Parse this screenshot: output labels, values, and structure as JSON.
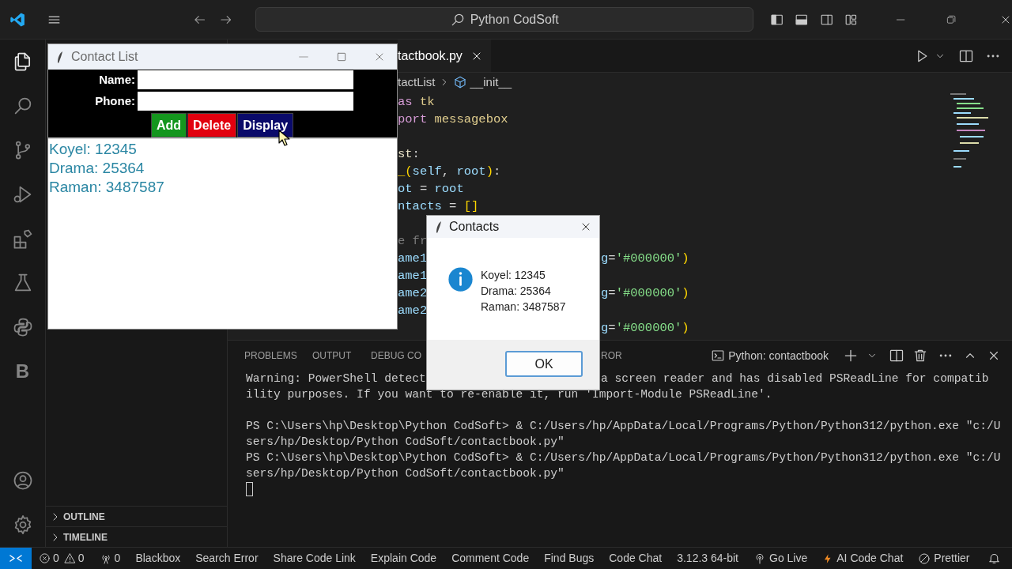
{
  "title_bar": {
    "search": "Python CodSoft"
  },
  "activity_bar": {
    "items": [
      {
        "kind": "files",
        "selected": true
      },
      {
        "kind": "search",
        "selected": false
      },
      {
        "kind": "source-control",
        "selected": false
      },
      {
        "kind": "run-debug",
        "selected": false
      },
      {
        "kind": "extensions",
        "selected": false
      },
      {
        "kind": "flask",
        "selected": false
      },
      {
        "kind": "python",
        "selected": false
      },
      {
        "kind": "letter",
        "label": "B",
        "selected": false
      }
    ],
    "bottom": [
      {
        "kind": "account"
      },
      {
        "kind": "gear"
      }
    ]
  },
  "sidebar": {
    "sections": [
      {
        "label": "OUTLINE",
        "expanded": false
      },
      {
        "label": "TIMELINE",
        "expanded": false
      }
    ]
  },
  "editor": {
    "tab": {
      "label": "tactbook.py"
    },
    "breadcrumbs": [
      "tactList",
      "__init__"
    ],
    "lines": [
      {
        "kind": "code",
        "left": [
          {
            "text": "as",
            "color": "#d69bd6"
          },
          {
            "text": " tk",
            "color": "#e0cd8e"
          }
        ]
      },
      {
        "kind": "code",
        "left": [
          {
            "text": "port",
            "color": "#d69bd6"
          },
          {
            "text": " messagebox",
            "color": "#e0cd8e"
          }
        ]
      },
      {
        "kind": "blank"
      },
      {
        "kind": "code",
        "left": [
          {
            "text": "st",
            "color": "#e8e2c8"
          },
          {
            "text": ":",
            "color": "#d4d4d4"
          }
        ]
      },
      {
        "kind": "code",
        "left": [
          {
            "text": "_(",
            "color": "#ffd700"
          },
          {
            "text": "self",
            "color": "#9cdcfe"
          },
          {
            "text": ",",
            "color": "#d4d4d4"
          },
          {
            "text": " root",
            "color": "#9cdcfe"
          },
          {
            "text": ")",
            "color": "#ffd700"
          },
          {
            "text": ":",
            "color": "#d4d4d4"
          }
        ]
      },
      {
        "kind": "code",
        "left": [
          {
            "text": "ot",
            "color": "#9cdcfe"
          },
          {
            "text": " = ",
            "color": "#d4d4d4"
          },
          {
            "text": "root",
            "color": "#9cdcfe"
          }
        ]
      },
      {
        "kind": "code",
        "left": [
          {
            "text": "ntacts",
            "color": "#9cdcfe"
          },
          {
            "text": " = ",
            "color": "#d4d4d4"
          },
          {
            "text": "[]",
            "color": "#ffd700"
          }
        ]
      },
      {
        "kind": "blank"
      },
      {
        "kind": "code",
        "left": [
          {
            "text": "e fr",
            "color": "#7a7a7a"
          }
        ]
      },
      {
        "kind": "code",
        "left": [
          {
            "text": "ame1",
            "color": "#9cdcfe"
          }
        ],
        "right": [
          {
            "text": "g",
            "color": "#9cdcfe"
          },
          {
            "text": "=",
            "color": "#d4d4d4"
          },
          {
            "text": "'#000000'",
            "color": "#86e08a"
          },
          {
            "text": ")",
            "color": "#ffd700"
          }
        ]
      },
      {
        "kind": "code",
        "left": [
          {
            "text": "ame1",
            "color": "#9cdcfe"
          }
        ]
      },
      {
        "kind": "code",
        "left": [
          {
            "text": "ame2",
            "color": "#9cdcfe"
          }
        ],
        "right": [
          {
            "text": "g",
            "color": "#9cdcfe"
          },
          {
            "text": "=",
            "color": "#d4d4d4"
          },
          {
            "text": "'#000000'",
            "color": "#86e08a"
          },
          {
            "text": ")",
            "color": "#ffd700"
          }
        ]
      },
      {
        "kind": "code",
        "left": [
          {
            "text": "ame2",
            "color": "#9cdcfe"
          }
        ]
      },
      {
        "kind": "code",
        "right": [
          {
            "text": "g",
            "color": "#9cdcfe"
          },
          {
            "text": "=",
            "color": "#d4d4d4"
          },
          {
            "text": "'#000000'",
            "color": "#86e08a"
          },
          {
            "text": ")",
            "color": "#ffd700"
          }
        ]
      }
    ]
  },
  "panel": {
    "tabs": [
      {
        "label": "PROBLEMS"
      },
      {
        "label": "OUTPUT"
      },
      {
        "label": "DEBUG CO"
      },
      {
        "label": "ROR"
      }
    ],
    "terminal_name": "Python: contactbook",
    "blocks": [
      [
        {
          "left": "Warning: PowerShell detect",
          "right": "a screen reader and has disabled PSReadLine for compatib"
        },
        {
          "left": "ility purposes. If you want to re-enable it, run 'Import-Module PSReadLine'."
        }
      ],
      [
        {
          "left": "PS C:\\Users\\hp\\Desktop\\Python CodSoft> & C:/Users/hp/AppData/Local/Programs/Python/Python312/python.exe \"c:/U"
        },
        {
          "left": "sers/hp/Desktop/Python CodSoft/contactbook.py\""
        },
        {
          "left": "PS C:\\Users\\hp\\Desktop\\Python CodSoft> & C:/Users/hp/AppData/Local/Programs/Python/Python312/python.exe \"c:/U"
        },
        {
          "left": "sers/hp/Desktop/Python CodSoft/contactbook.py\""
        }
      ]
    ]
  },
  "status_bar": {
    "items": [
      {
        "kind": "remote"
      },
      {
        "kind": "problems",
        "errors": "0",
        "warnings": "0"
      },
      {
        "kind": "ports",
        "text": "0"
      },
      {
        "kind": "text",
        "text": "Blackbox"
      },
      {
        "kind": "text",
        "text": "Search Error"
      },
      {
        "kind": "text",
        "text": "Share Code Link"
      },
      {
        "kind": "text",
        "text": "Explain Code"
      },
      {
        "kind": "text",
        "text": "Comment Code"
      },
      {
        "kind": "text",
        "text": "Find Bugs"
      },
      {
        "kind": "text",
        "text": "Code Chat"
      },
      {
        "kind": "text",
        "text": "3.12.3 64-bit"
      },
      {
        "kind": "live",
        "text": "Go Live"
      },
      {
        "kind": "ai",
        "text": "AI Code Chat"
      },
      {
        "kind": "prettier",
        "text": "Prettier"
      },
      {
        "kind": "bell"
      }
    ]
  },
  "contact_window": {
    "title": "Contact List",
    "fields": [
      {
        "label": "Name:"
      },
      {
        "label": "Phone:"
      }
    ],
    "buttons": [
      {
        "label": "Add",
        "color": "#14961e"
      },
      {
        "label": "Delete",
        "color": "#e2000f"
      },
      {
        "label": "Display",
        "color": "#0a0a6a"
      }
    ],
    "entries": [
      "Koyel: 12345",
      "Drama: 25364",
      "Raman: 3487587"
    ]
  },
  "dialog": {
    "title": "Contacts",
    "message_lines": [
      "Koyel: 12345",
      "Drama: 25364",
      "Raman: 3487587"
    ],
    "button": "OK"
  }
}
